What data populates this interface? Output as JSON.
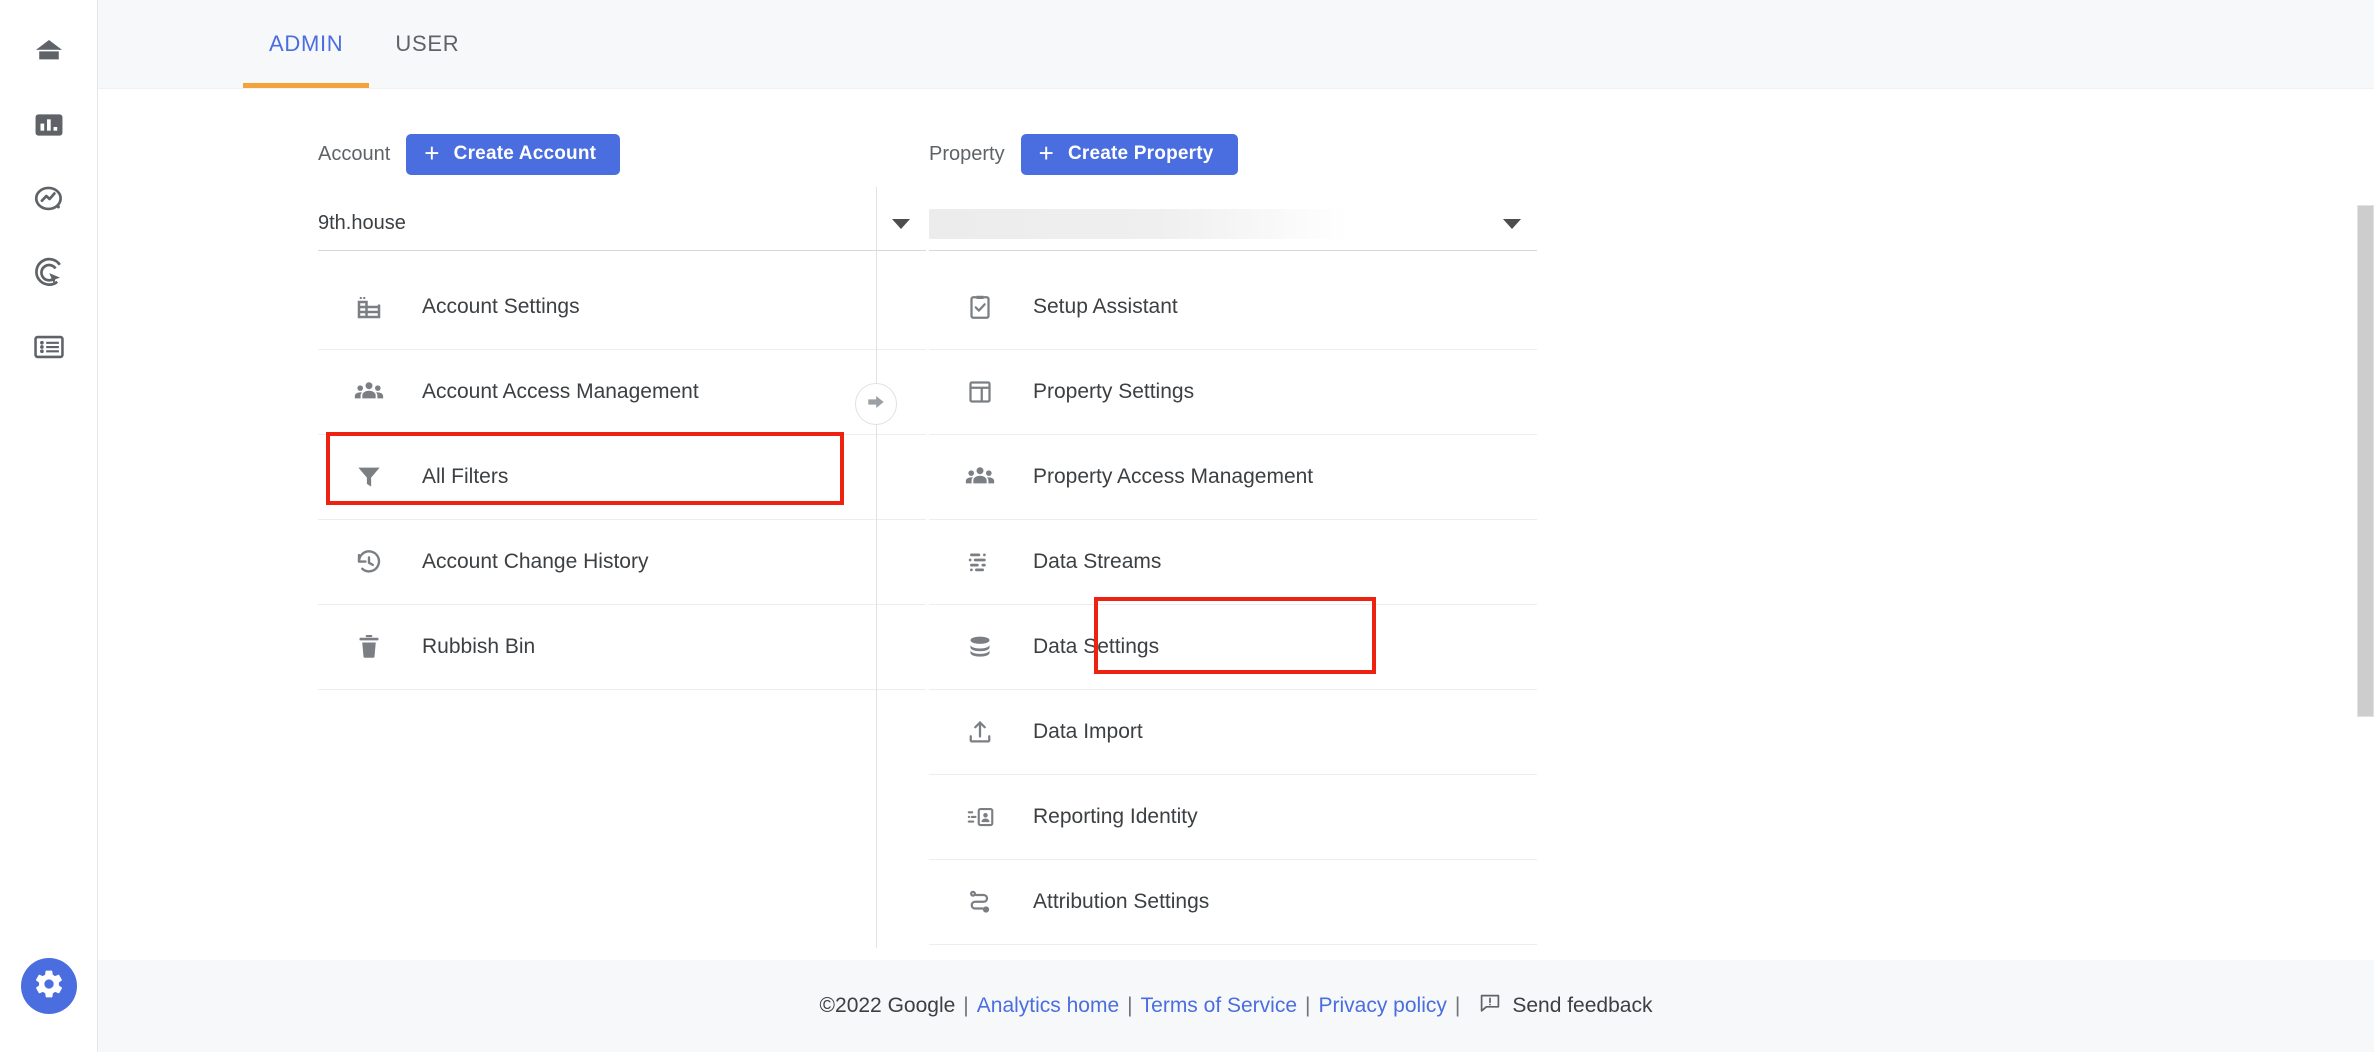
{
  "rail": {
    "items": [
      {
        "name": "home",
        "icon": "home-icon"
      },
      {
        "name": "reports",
        "icon": "bar-chart-icon"
      },
      {
        "name": "explore",
        "icon": "explore-icon"
      },
      {
        "name": "advertising",
        "icon": "bullseye-icon"
      },
      {
        "name": "library",
        "icon": "list-icon"
      }
    ],
    "fab": {
      "name": "admin",
      "icon": "gear-icon"
    }
  },
  "tabs": [
    {
      "id": "admin",
      "label": "ADMIN",
      "active": true
    },
    {
      "id": "user",
      "label": "USER",
      "active": false
    }
  ],
  "account": {
    "label": "Account",
    "create_label": "Create Account",
    "plus": "+",
    "selected": "9th.house",
    "caret": "chevron-down-icon",
    "items": [
      {
        "label": "Account Settings",
        "icon": "building-icon"
      },
      {
        "label": "Account Access Management",
        "icon": "people-icon",
        "highlighted": true
      },
      {
        "label": "All Filters",
        "icon": "funnel-icon"
      },
      {
        "label": "Account Change History",
        "icon": "history-icon"
      },
      {
        "label": "Rubbish Bin",
        "icon": "trash-icon"
      }
    ]
  },
  "switch_button": {
    "icon": "arrow-right-circle-icon"
  },
  "property": {
    "label": "Property",
    "create_label": "Create Property",
    "plus": "+",
    "selected": "",
    "caret": "chevron-down-icon",
    "items": [
      {
        "label": "Setup Assistant",
        "icon": "clipboard-check-icon"
      },
      {
        "label": "Property Settings",
        "icon": "layout-icon"
      },
      {
        "label": "Property Access Management",
        "icon": "people-icon"
      },
      {
        "label": "Data Streams",
        "icon": "data-streams-icon",
        "highlighted": true
      },
      {
        "label": "Data Settings",
        "icon": "database-icon"
      },
      {
        "label": "Data Import",
        "icon": "upload-icon"
      },
      {
        "label": "Reporting Identity",
        "icon": "reporting-identity-icon"
      },
      {
        "label": "Attribution Settings",
        "icon": "attribution-icon"
      }
    ]
  },
  "footer": {
    "copyright": "©2022 Google",
    "sep": "|",
    "links": [
      {
        "label": "Analytics home"
      },
      {
        "label": "Terms of Service"
      },
      {
        "label": "Privacy policy"
      }
    ],
    "feedback_label": "Send feedback",
    "feedback_icon": "feedback-icon"
  },
  "colors": {
    "accent_blue": "#4a6ee0",
    "tab_underline_orange": "#f2a33c",
    "highlight_red": "#ee2211",
    "page_bg": "#f7f8fa",
    "text": "#3c4043",
    "muted_text": "#5f6368",
    "icon_gray": "#7b7f84"
  }
}
